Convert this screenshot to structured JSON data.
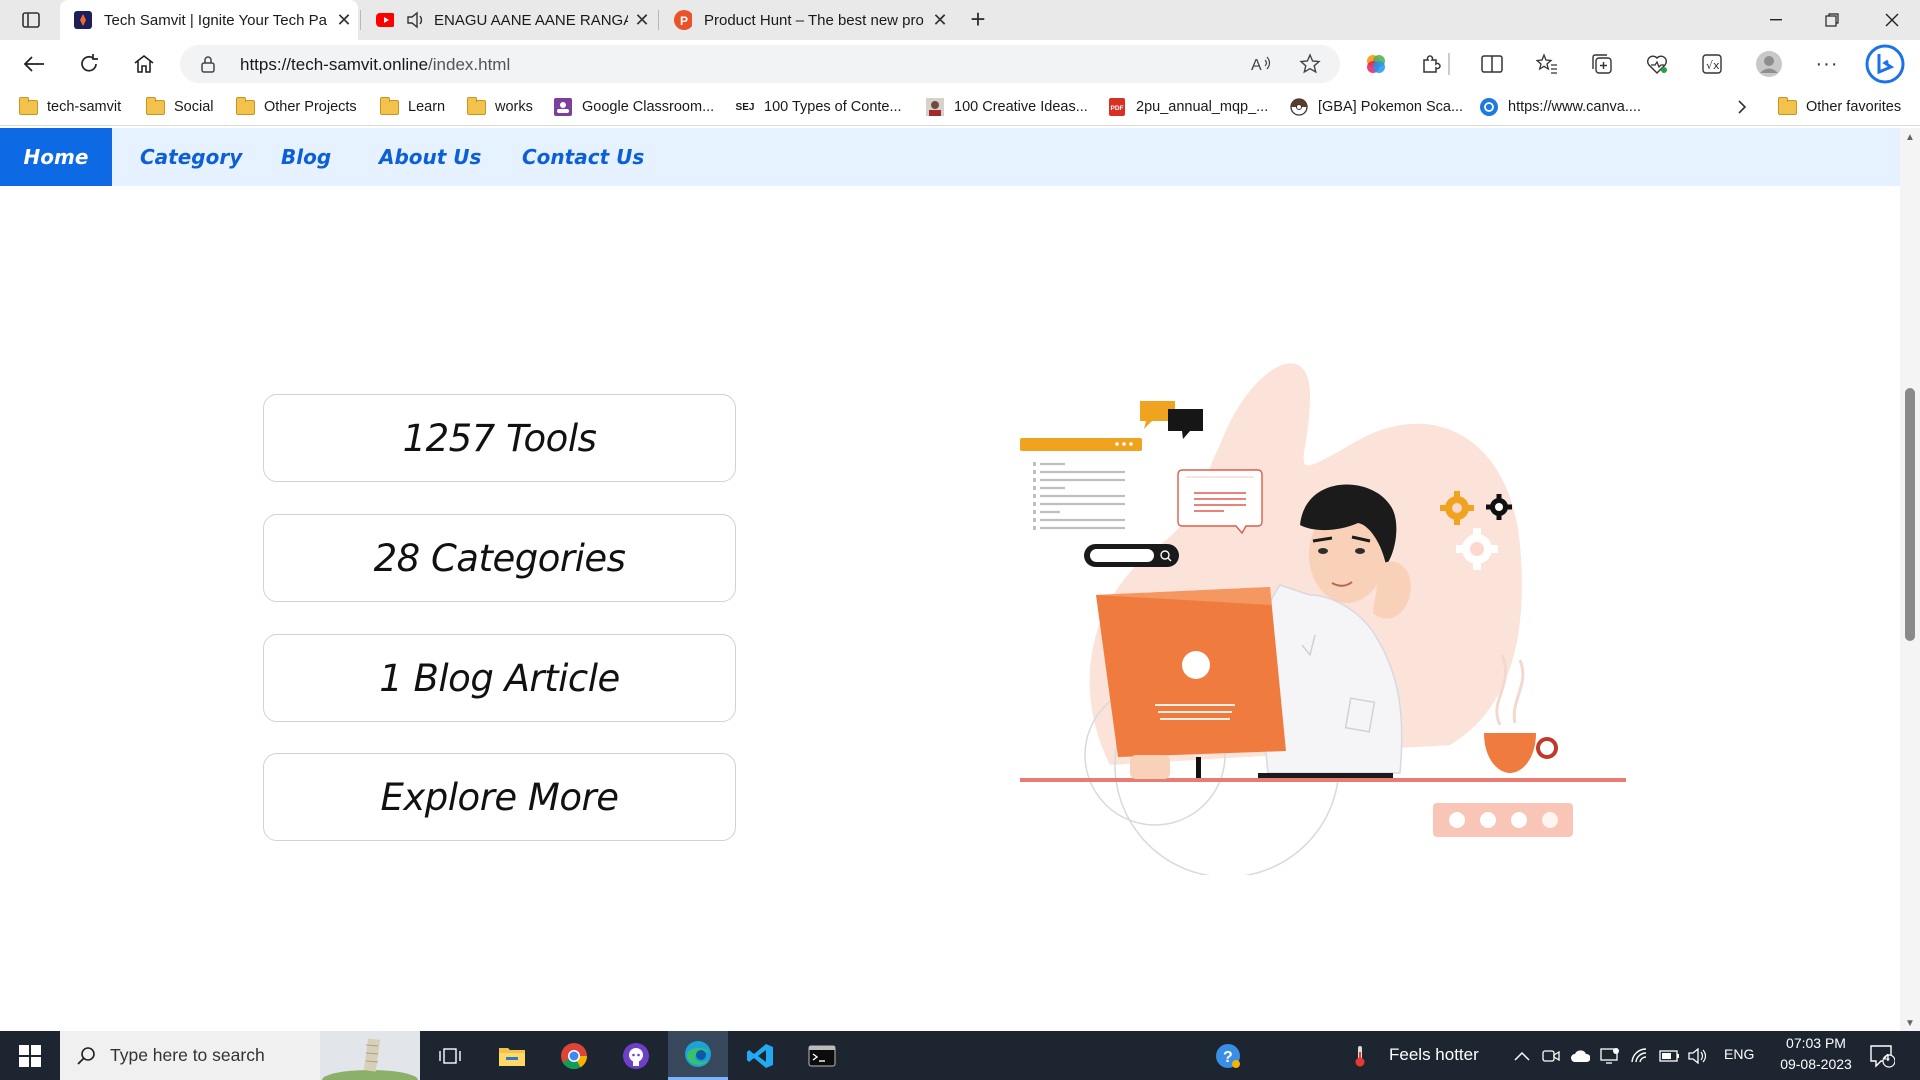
{
  "browser": {
    "tabs": [
      {
        "title": "Tech Samvit | Ignite Your Tech Pa",
        "active": true
      },
      {
        "title": "ENAGU AANE AANE RANGA",
        "active": false,
        "audio": true
      },
      {
        "title": "Product Hunt – The best new pro",
        "active": false
      }
    ],
    "address_bar": {
      "url_host": "https://tech-samvit.online",
      "url_path": "/index.html"
    },
    "bookmarks": [
      {
        "label": "tech-samvit",
        "icon": "folder-icon"
      },
      {
        "label": "Social",
        "icon": "folder-icon"
      },
      {
        "label": "Other Projects",
        "icon": "folder-icon"
      },
      {
        "label": "Learn",
        "icon": "folder-icon"
      },
      {
        "label": "works",
        "icon": "folder-icon"
      },
      {
        "label": "Google Classroom...",
        "icon": "classroom-icon"
      },
      {
        "label": "100 Types of Conte...",
        "icon": "sej-icon"
      },
      {
        "label": "100 Creative Ideas...",
        "icon": "person-icon"
      },
      {
        "label": "2pu_annual_mqp_...",
        "icon": "pdf-icon"
      },
      {
        "label": "[GBA] Pokemon Sca...",
        "icon": "pokeball-icon"
      },
      {
        "label": "https://www.canva....",
        "icon": "canva-icon"
      }
    ],
    "bookmarks_other": "Other favorites",
    "sej_badge": "SEJ",
    "pdf_badge": "PDF"
  },
  "site": {
    "nav": [
      {
        "label": "Home",
        "active": true
      },
      {
        "label": "Category",
        "active": false
      },
      {
        "label": "Blog",
        "active": false
      },
      {
        "label": "About Us",
        "active": false
      },
      {
        "label": "Contact Us",
        "active": false
      }
    ],
    "stats": [
      {
        "label": "1257 Tools"
      },
      {
        "label": "28 Categories"
      },
      {
        "label": "1 Blog Article"
      },
      {
        "label": "Explore More"
      }
    ]
  },
  "taskbar": {
    "search_placeholder": "Type here to search",
    "weather": "Feels hotter",
    "language": "ENG",
    "time": "07:03 PM",
    "date": "09-08-2023",
    "notification_count": "4"
  },
  "colors": {
    "nav_active_bg": "#0d6ae4",
    "nav_text": "#0d5fd8",
    "nav_bg": "#e6f2ff",
    "illustration_orange": "#f07b3f",
    "illustration_peach": "#fbd9cc"
  }
}
